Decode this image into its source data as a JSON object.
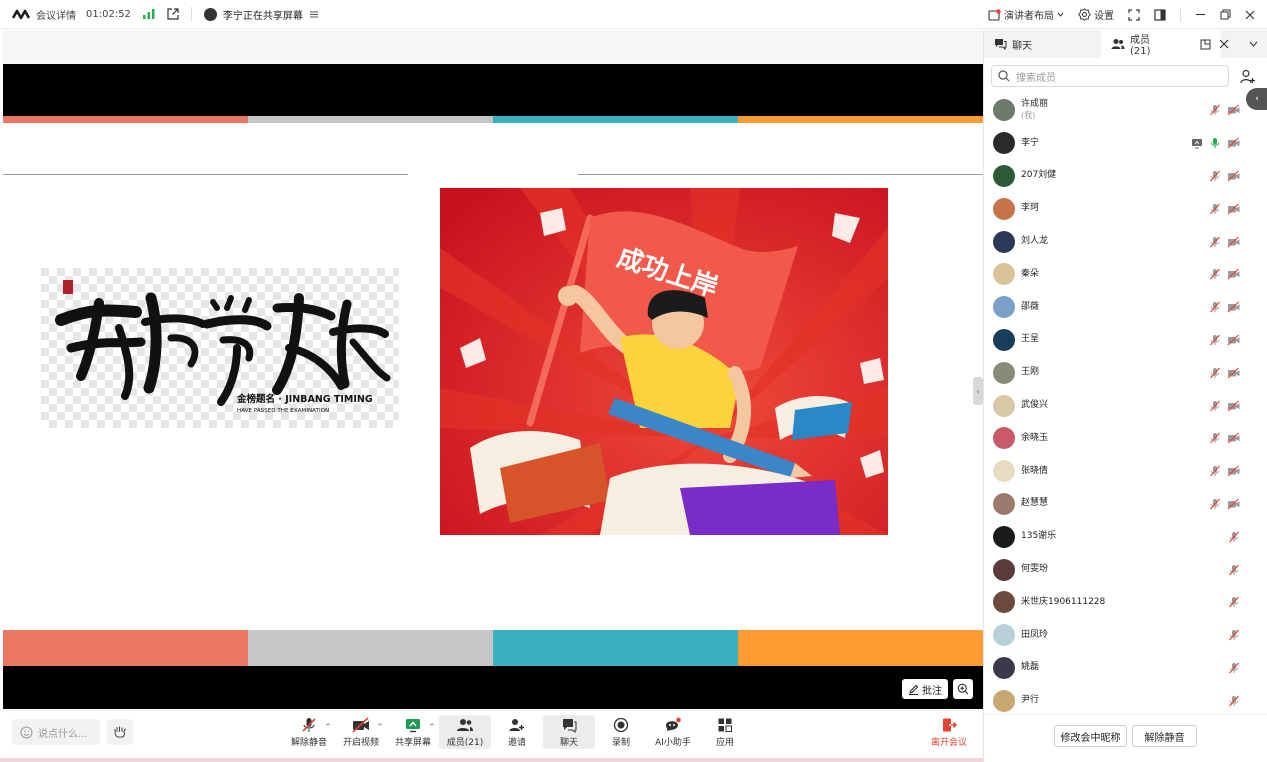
{
  "topbar": {
    "meeting_details": "会议详情",
    "timer": "01:02:52",
    "sharing_status": "李宁正在共享屏幕",
    "layout_label": "演讲者布局",
    "settings_label": "设置"
  },
  "slide": {
    "poster_title": "成功上岸",
    "calligraphy_caption": "金榜题名 · JINBANG TIMING",
    "calligraphy_subcaption": "HAVE PASSED THE EXAMINATION",
    "stripe_colors": [
      "#ec7764",
      "#c6c6c6",
      "#39b1c0",
      "#fe9c34"
    ],
    "annotate_label": "批注"
  },
  "toolbar": {
    "chat_placeholder": "说点什么...",
    "items": [
      {
        "label": "解除静音",
        "icon": "mic-muted-icon"
      },
      {
        "label": "开启视频",
        "icon": "video-off-icon"
      },
      {
        "label": "共享屏幕",
        "icon": "share-screen-icon"
      },
      {
        "label": "成员(21)",
        "icon": "members-icon"
      },
      {
        "label": "邀请",
        "icon": "invite-icon"
      },
      {
        "label": "聊天",
        "icon": "chat-icon"
      },
      {
        "label": "录制",
        "icon": "record-icon"
      },
      {
        "label": "AI小助手",
        "icon": "ai-assistant-icon"
      },
      {
        "label": "应用",
        "icon": "apps-icon"
      }
    ],
    "leave_label": "离开会议",
    "leave_color": "#e5432f"
  },
  "panel": {
    "tab_chat": "聊天",
    "tab_members": "成员(21)",
    "search_placeholder": "搜索成员",
    "members": [
      {
        "name": "许成丽",
        "sub": "(我)",
        "avatar_color": "#6b7a6a",
        "mic": "muted",
        "video": "off"
      },
      {
        "name": "李宁",
        "sub": "",
        "avatar_color": "#2a2a2a",
        "mic": "on",
        "video": "off",
        "sharing": true
      },
      {
        "name": "207刘健",
        "sub": "",
        "avatar_color": "#2f5a3a",
        "mic": "muted",
        "video": "off"
      },
      {
        "name": "李珂",
        "sub": "",
        "avatar_color": "#c8744a",
        "mic": "muted",
        "video": "off"
      },
      {
        "name": "刘人龙",
        "sub": "",
        "avatar_color": "#2c3a5a",
        "mic": "muted",
        "video": "off"
      },
      {
        "name": "秦朵",
        "sub": "",
        "avatar_color": "#d9c49a",
        "mic": "muted",
        "video": "off"
      },
      {
        "name": "邵薇",
        "sub": "",
        "avatar_color": "#7aa0c8",
        "mic": "muted",
        "video": "off"
      },
      {
        "name": "王呈",
        "sub": "",
        "avatar_color": "#1a3d5a",
        "mic": "muted",
        "video": "off"
      },
      {
        "name": "王刚",
        "sub": "",
        "avatar_color": "#8a8a7a",
        "mic": "muted",
        "video": "off"
      },
      {
        "name": "武俊兴",
        "sub": "",
        "avatar_color": "#d8c8a8",
        "mic": "muted",
        "video": "off"
      },
      {
        "name": "余晓玉",
        "sub": "",
        "avatar_color": "#c85a6a",
        "mic": "muted",
        "video": "off"
      },
      {
        "name": "张晓倩",
        "sub": "",
        "avatar_color": "#e8dcc0",
        "mic": "muted",
        "video": "off"
      },
      {
        "name": "赵慧慧",
        "sub": "",
        "avatar_color": "#9a7a6a",
        "mic": "muted",
        "video": "off"
      },
      {
        "name": "135谢乐",
        "sub": "",
        "avatar_color": "#1a1a1a",
        "mic": "muted",
        "video": ""
      },
      {
        "name": "何雯玢",
        "sub": "",
        "avatar_color": "#5a3a3a",
        "mic": "muted",
        "video": ""
      },
      {
        "name": "米世庆1906111228",
        "sub": "",
        "avatar_color": "#6a4a3a",
        "mic": "muted",
        "video": ""
      },
      {
        "name": "田凤玲",
        "sub": "",
        "avatar_color": "#b8d0d8",
        "mic": "muted",
        "video": ""
      },
      {
        "name": "姚磊",
        "sub": "",
        "avatar_color": "#3a3a4a",
        "mic": "muted",
        "video": ""
      },
      {
        "name": "尹行",
        "sub": "",
        "avatar_color": "#c8a870",
        "mic": "muted",
        "video": ""
      }
    ],
    "rename_button": "修改会中昵称",
    "unmute_all_button": "解除静音"
  }
}
